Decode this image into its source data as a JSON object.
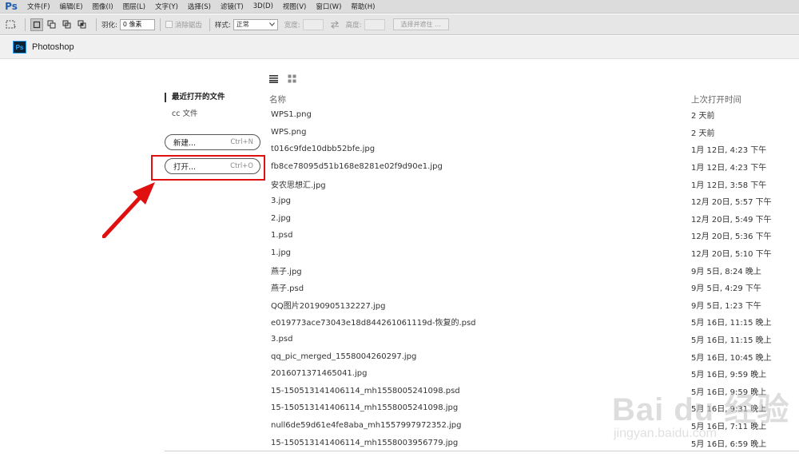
{
  "menubar": {
    "logo": "Ps",
    "items": [
      "文件(F)",
      "编辑(E)",
      "图像(I)",
      "图层(L)",
      "文字(Y)",
      "选择(S)",
      "滤镜(T)",
      "3D(D)",
      "视图(V)",
      "窗口(W)",
      "帮助(H)"
    ]
  },
  "options": {
    "feather_label": "羽化:",
    "feather_value": "0 像素",
    "antialias_label": "消除锯齿",
    "style_label": "样式:",
    "style_value": "正常",
    "width_label": "宽度:",
    "height_label": "高度:",
    "select_mask_button": "选择并遮住 ..."
  },
  "header": {
    "logo": "Ps",
    "title": "Photoshop"
  },
  "sidebar": {
    "recent_label": "最近打开的文件",
    "cc_label": "cc 文件",
    "new_label": "新建...",
    "new_shortcut": "Ctrl+N",
    "open_label": "打开...",
    "open_shortcut": "Ctrl+O"
  },
  "table": {
    "col_name": "名称",
    "col_date": "上次打开时间",
    "rows": [
      {
        "name": "WPS1.png",
        "date": "2 天前"
      },
      {
        "name": "WPS.png",
        "date": "2 天前"
      },
      {
        "name": "t016c9fde10dbb52bfe.jpg",
        "date": "1月 12日, 4:23 下午"
      },
      {
        "name": "fb8ce78095d51b168e8281e02f9d90e1.jpg",
        "date": "1月 12日, 4:23 下午"
      },
      {
        "name": "安农思想汇.jpg",
        "date": "1月 12日, 3:58 下午"
      },
      {
        "name": "3.jpg",
        "date": "12月 20日, 5:57 下午"
      },
      {
        "name": "2.jpg",
        "date": "12月 20日, 5:49 下午"
      },
      {
        "name": "1.psd",
        "date": "12月 20日, 5:36 下午"
      },
      {
        "name": "1.jpg",
        "date": "12月 20日, 5:10 下午"
      },
      {
        "name": "燕子.jpg",
        "date": "9月 5日, 8:24 晚上"
      },
      {
        "name": "燕子.psd",
        "date": "9月 5日, 4:29 下午"
      },
      {
        "name": "QQ图片20190905132227.jpg",
        "date": "9月 5日, 1:23 下午"
      },
      {
        "name": "e019773ace73043e18d844261061119d-恢复的.psd",
        "date": "5月 16日, 11:15 晚上"
      },
      {
        "name": "3.psd",
        "date": "5月 16日, 11:15 晚上"
      },
      {
        "name": "qq_pic_merged_1558004260297.jpg",
        "date": "5月 16日, 10:45 晚上"
      },
      {
        "name": "2016071371465041.jpg",
        "date": "5月 16日, 9:59 晚上"
      },
      {
        "name": "15-150513141406114_mh1558005241098.psd",
        "date": "5月 16日, 9:59 晚上"
      },
      {
        "name": "15-150513141406114_mh1558005241098.jpg",
        "date": "5月 16日, 9:31 晚上"
      },
      {
        "name": "null6de59d61e4fe8aba_mh1557997972352.jpg",
        "date": "5月 16日, 7:11 晚上"
      },
      {
        "name": "15-150513141406114_mh1558003956779.jpg",
        "date": "5月 16日, 6:59 晚上"
      }
    ]
  },
  "watermark": {
    "main": "Bai du 经验",
    "sub": "jingyan.baidu.com"
  },
  "colors": {
    "highlight": "#e01010",
    "ps_blue": "#31a8ff"
  }
}
